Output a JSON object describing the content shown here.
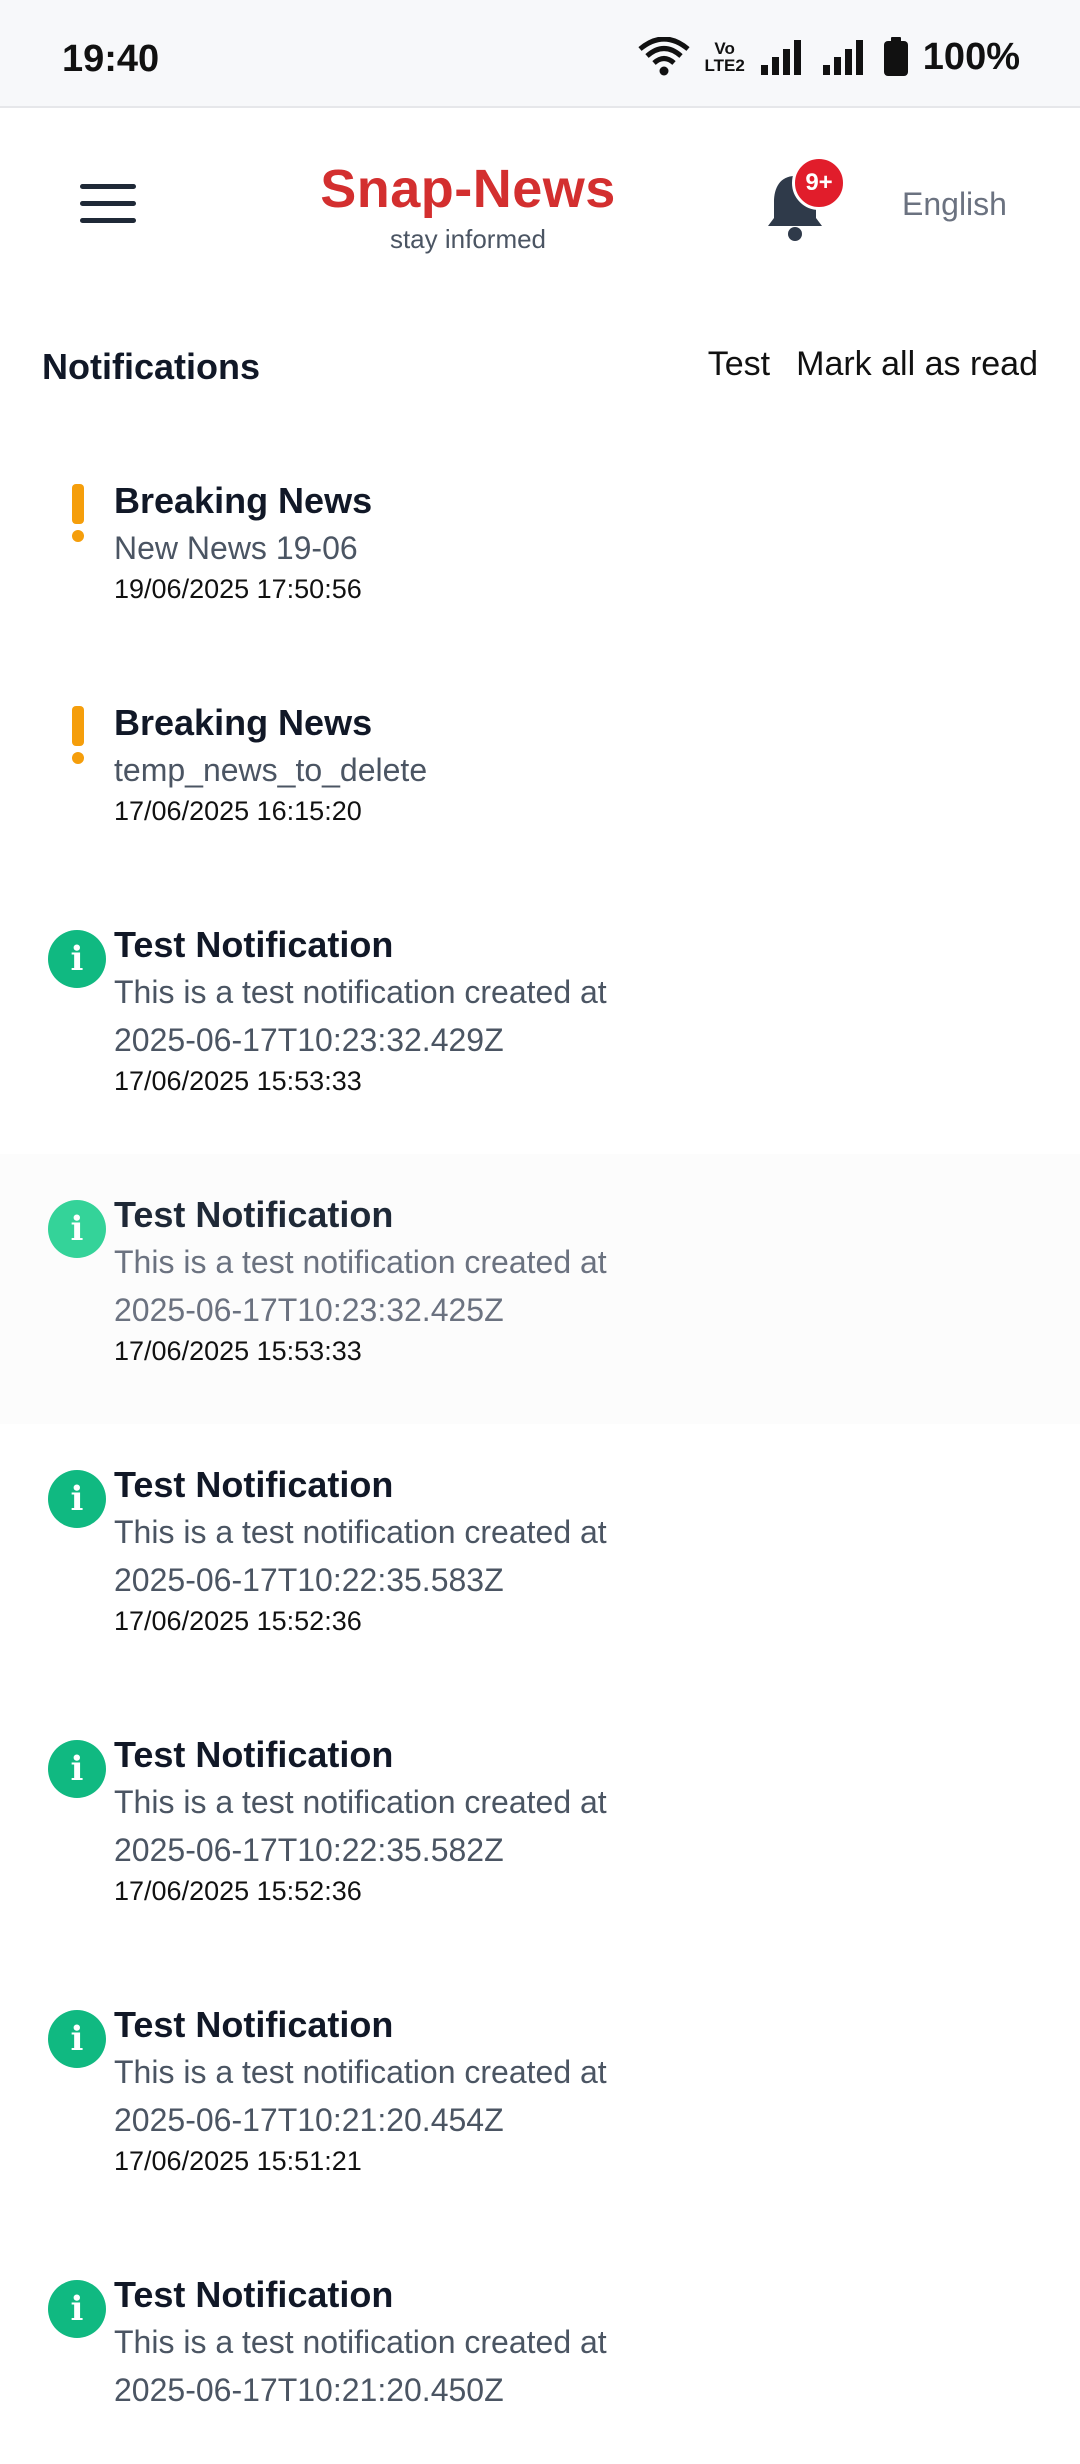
{
  "status_bar": {
    "time": "19:40",
    "battery": "100%",
    "volte_line1": "Vo",
    "volte_line2": "LTE2"
  },
  "header": {
    "brand": "Snap-News",
    "tagline": "stay informed",
    "badge": "9+",
    "language": "English"
  },
  "notifications_header": {
    "title": "Notifications",
    "test_label": "Test",
    "mark_all_label": "Mark all as read"
  },
  "colors": {
    "brand": "#d32f2f",
    "warning": "#f59e0b",
    "info": "#10b981",
    "badge": "#e11d2b"
  },
  "notifications": [
    {
      "type": "warning",
      "title": "Breaking News",
      "message": "New News 19-06",
      "message_line2": "",
      "date": "19/06/2025 17:50:56",
      "read": false
    },
    {
      "type": "warning",
      "title": "Breaking News",
      "message": "temp_news_to_delete",
      "message_line2": "",
      "date": "17/06/2025 16:15:20",
      "read": false
    },
    {
      "type": "info",
      "title": "Test Notification",
      "message": "This is a test notification created at",
      "message_line2": "2025-06-17T10:23:32.429Z",
      "date": "17/06/2025 15:53:33",
      "read": false
    },
    {
      "type": "info",
      "title": "Test Notification",
      "message": "This is a test notification created at",
      "message_line2": "2025-06-17T10:23:32.425Z",
      "date": "17/06/2025 15:53:33",
      "read": true
    },
    {
      "type": "info",
      "title": "Test Notification",
      "message": "This is a test notification created at",
      "message_line2": "2025-06-17T10:22:35.583Z",
      "date": "17/06/2025 15:52:36",
      "read": false
    },
    {
      "type": "info",
      "title": "Test Notification",
      "message": "This is a test notification created at",
      "message_line2": "2025-06-17T10:22:35.582Z",
      "date": "17/06/2025 15:52:36",
      "read": false
    },
    {
      "type": "info",
      "title": "Test Notification",
      "message": "This is a test notification created at",
      "message_line2": "2025-06-17T10:21:20.454Z",
      "date": "17/06/2025 15:51:21",
      "read": false
    },
    {
      "type": "info",
      "title": "Test Notification",
      "message": "This is a test notification created at",
      "message_line2": "2025-06-17T10:21:20.450Z",
      "date": "",
      "read": false
    }
  ]
}
